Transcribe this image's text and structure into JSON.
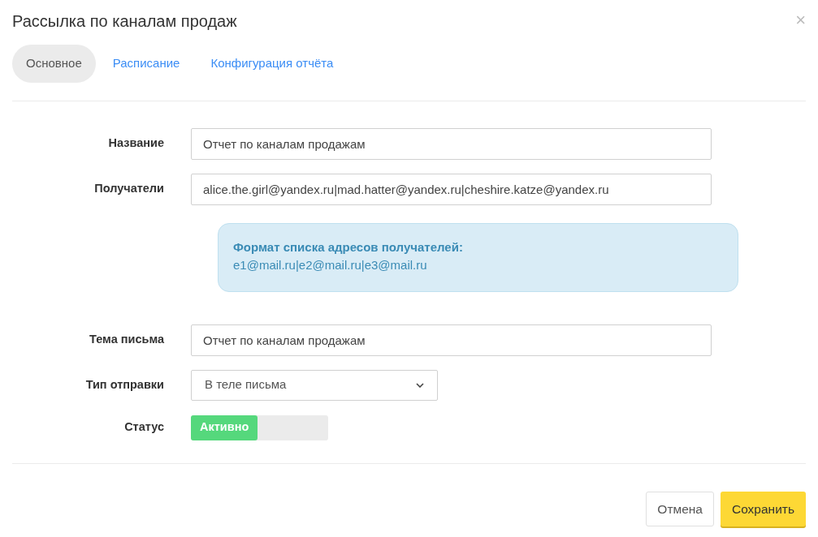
{
  "dialog": {
    "title": "Рассылка по каналам продаж",
    "close": "×"
  },
  "tabs": [
    {
      "label": "Основное",
      "selected": true
    },
    {
      "label": "Расписание",
      "selected": false
    },
    {
      "label": "Конфигурация отчёта",
      "selected": false
    }
  ],
  "fields": [
    {
      "kind": "text",
      "label": "Название",
      "value": "Отчет по каналам продажам"
    },
    {
      "kind": "text",
      "label": "Получатели",
      "value": "alice.the.girl@yandex.ru|mad.hatter@yandex.ru|cheshire.katze@yandex.ru",
      "hint": {
        "title": "Формат списка адресов получателей:",
        "text": "e1@mail.ru|e2@mail.ru|e3@mail.ru"
      }
    },
    {
      "kind": "text",
      "label": "Тема письма",
      "value": "Отчет по каналам продажам"
    },
    {
      "kind": "select",
      "label": "Тип отправки",
      "value": "В теле письма"
    },
    {
      "kind": "toggle",
      "label": "Статус",
      "value": "Активно",
      "on": true
    }
  ],
  "buttons": [
    {
      "label": "Отмена",
      "kind": "secondary"
    },
    {
      "label": "Сохранить",
      "kind": "primary"
    }
  ]
}
